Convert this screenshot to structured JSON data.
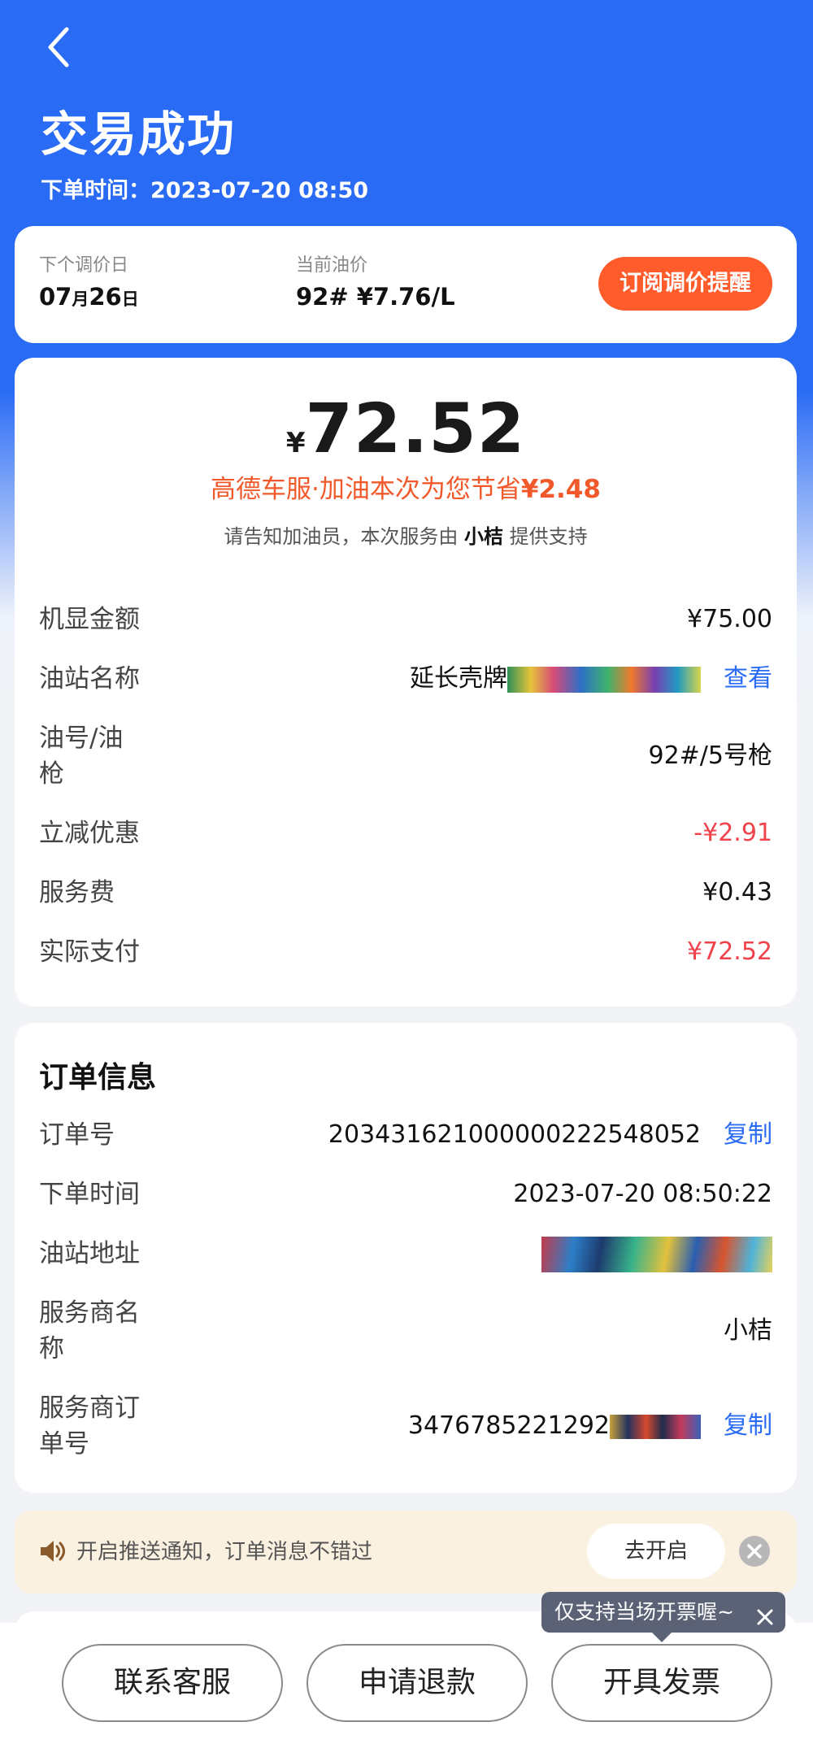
{
  "header": {
    "title": "交易成功",
    "order_time_label": "下单时间：2023-07-20 08:50"
  },
  "price_notice": {
    "next_adjust_label": "下个调价日",
    "next_adjust_month": "07",
    "next_adjust_month_unit": "月",
    "next_adjust_day": "26",
    "next_adjust_day_unit": "日",
    "current_price_label": "当前油价",
    "current_price_value": "92# ¥7.76/L",
    "subscribe_button": "订阅调价提醒"
  },
  "payment": {
    "currency_symbol": "¥",
    "amount": "72.52",
    "save_prefix": "高德车服·加油本次为您节省",
    "save_amount": "¥2.48",
    "support_prefix": "请告知加油员，本次服务由 ",
    "support_provider": "小桔",
    "support_suffix": " 提供支持",
    "rows": [
      {
        "label": "机显金额",
        "value": "¥75.00"
      },
      {
        "label": "油站名称",
        "value": "延长壳牌",
        "link": "查看"
      },
      {
        "label": "油号/油\n枪",
        "value": "92#/5号枪"
      },
      {
        "label": "立减优惠",
        "value": "-¥2.91"
      },
      {
        "label": "服务费",
        "value": "¥0.43"
      },
      {
        "label": "实际支付",
        "value": "¥72.52"
      }
    ]
  },
  "order_info": {
    "title": "订单信息",
    "rows": [
      {
        "label": "订单号",
        "value": "20343162100000022254805​2",
        "link": "复制"
      },
      {
        "label": "下单时间",
        "value": "2023-07-20 08:50:22"
      },
      {
        "label": "油站地址",
        "value": ""
      },
      {
        "label": "服务商名\n称",
        "value": "小桔"
      },
      {
        "label": "服务商订\n单号",
        "value": "3476785221292",
        "link": "复制"
      }
    ]
  },
  "push_notice": {
    "text": "开启推送通知，订单消息不错过",
    "open_button": "去开启"
  },
  "tooltip": {
    "text": "仅支持当场开票喔~"
  },
  "bottom_bar": {
    "contact_button": "联系客服",
    "refund_button": "申请退款",
    "invoice_button": "开具发票"
  },
  "colors": {
    "brand_blue": "#2a6bf5",
    "accent_orange": "#ff5b2b",
    "discount_red": "#f0424a"
  }
}
